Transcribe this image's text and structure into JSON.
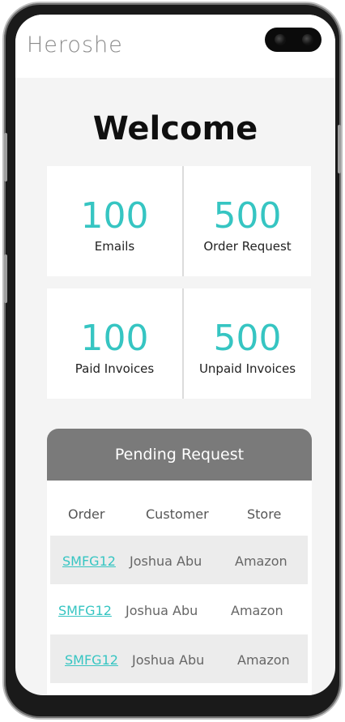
{
  "app": {
    "logo": "Heroshe"
  },
  "welcome": "Welcome",
  "stats": [
    {
      "value": "100",
      "label": "Emails"
    },
    {
      "value": "500",
      "label": "Order Request"
    },
    {
      "value": "100",
      "label": "Paid Invoices"
    },
    {
      "value": "500",
      "label": "Unpaid Invoices"
    }
  ],
  "pending": {
    "title": "Pending Request",
    "columns": [
      "Order",
      "Customer",
      "Store"
    ],
    "rows": [
      {
        "order": "SMFG12",
        "customer": "Joshua Abu",
        "store": "Amazon"
      },
      {
        "order": "SMFG12",
        "customer": "Joshua Abu",
        "store": "Amazon"
      },
      {
        "order": "SMFG12",
        "customer": "Joshua Abu",
        "store": "Amazon"
      }
    ]
  },
  "colors": {
    "accent": "#36c5c2",
    "header_bar": "#7a7a7a",
    "background": "#f4f4f4"
  }
}
